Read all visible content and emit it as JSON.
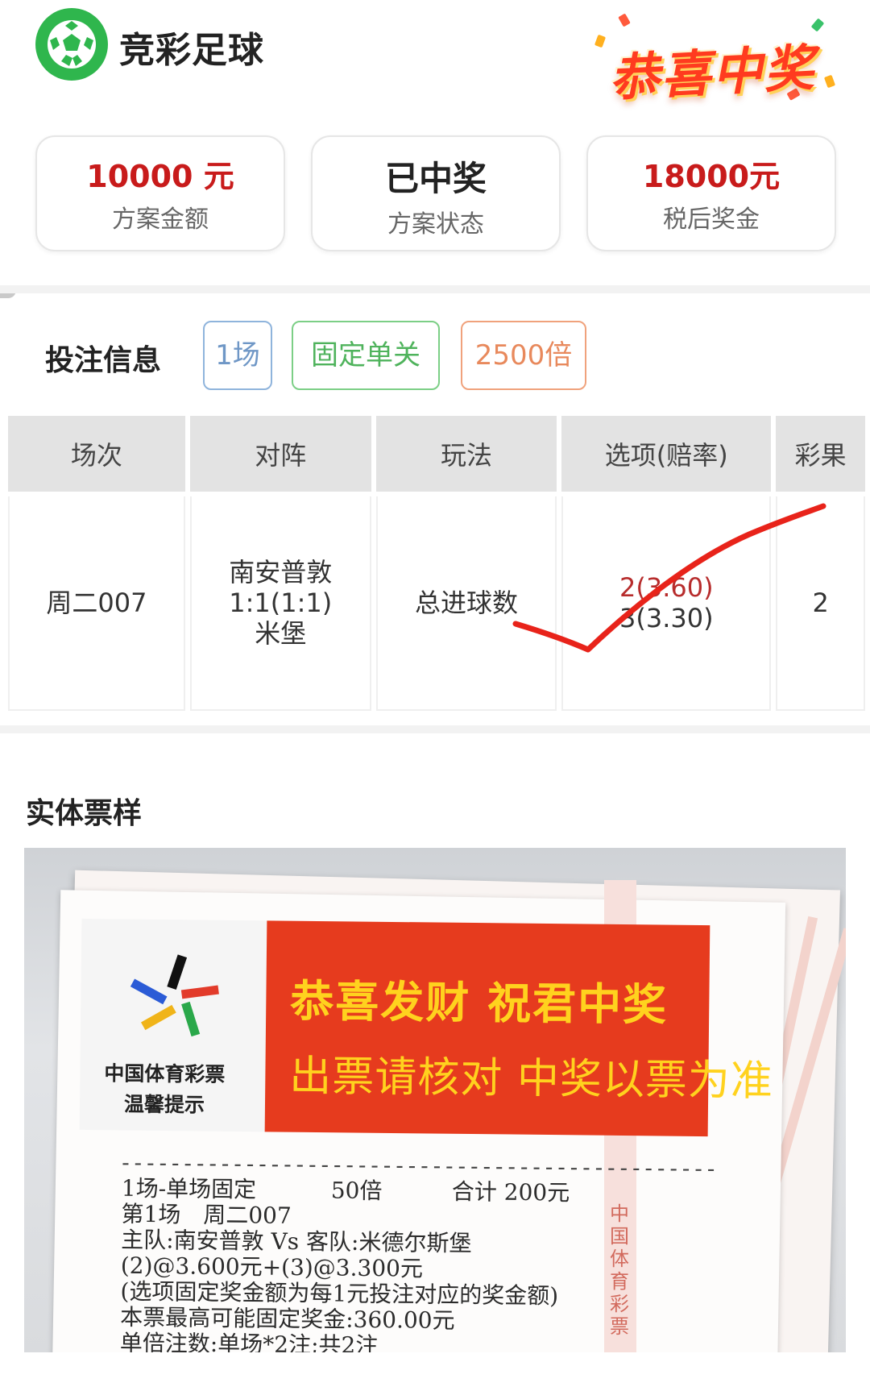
{
  "header": {
    "app_title": "竞彩足球",
    "congrats_badge": "恭喜中奖"
  },
  "stats": [
    {
      "value": "10000 元",
      "label": "方案金额"
    },
    {
      "value": "已中奖",
      "label": "方案状态"
    },
    {
      "value": "18000元",
      "label": "税后奖金"
    }
  ],
  "bet_info": {
    "title": "投注信息",
    "tags": [
      "1场",
      "固定单关",
      "2500倍"
    ]
  },
  "table": {
    "headers": [
      "场次",
      "对阵",
      "玩法",
      "选项(赔率)",
      "彩果"
    ],
    "row": {
      "match_no": "周二007",
      "home": "南安普敦",
      "score": "1:1(1:1)",
      "away": "米堡",
      "play": "总进球数",
      "option1": "2(3.60)",
      "option2": "3(3.30)",
      "result": "2"
    }
  },
  "sample": {
    "title": "实体票样",
    "banner_line1": "恭喜发财 祝君中奖",
    "banner_line2": "出票请核对 中奖以票为准",
    "org_name": "中国体育彩票",
    "org_tip": "温馨提示",
    "stripe_text": "中国体育彩票",
    "ticket": {
      "dash": "------------------------------------------------",
      "line1_a": "1场-单场固定",
      "line1_b": "50倍",
      "line1_c": "合计 200元",
      "line2": "第1场　周二007",
      "line3": "主队:南安普敦 Vs 客队:米德尔斯堡",
      "line4": "(2)@3.600元+(3)@3.300元",
      "line5": "(选项固定奖金额为每1元投注对应的奖金额)",
      "line6": "本票最高可能固定奖金:360.00元",
      "line7": "单倍注数:单场*2注;共2注"
    }
  },
  "colors": {
    "brand_green": "#2fb64d",
    "amount_red": "#c81b1b",
    "check_red": "#e8231a",
    "tag_blue": "#6f97c6",
    "tag_green": "#4fb35c",
    "tag_orange": "#e8895c"
  }
}
